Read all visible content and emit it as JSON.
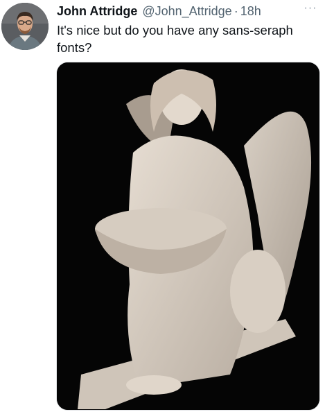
{
  "tweet": {
    "author_name": "John Attridge",
    "author_handle": "@John_Attridge",
    "separator": "·",
    "timestamp": "18h",
    "more_label": "···",
    "text": "It's nice but do you have any sans-seraph fonts?"
  },
  "colors": {
    "text_primary": "#0f1419",
    "text_secondary": "#536471",
    "media_background": "#050505"
  },
  "icons": {
    "more": "more-horizontal-icon"
  }
}
